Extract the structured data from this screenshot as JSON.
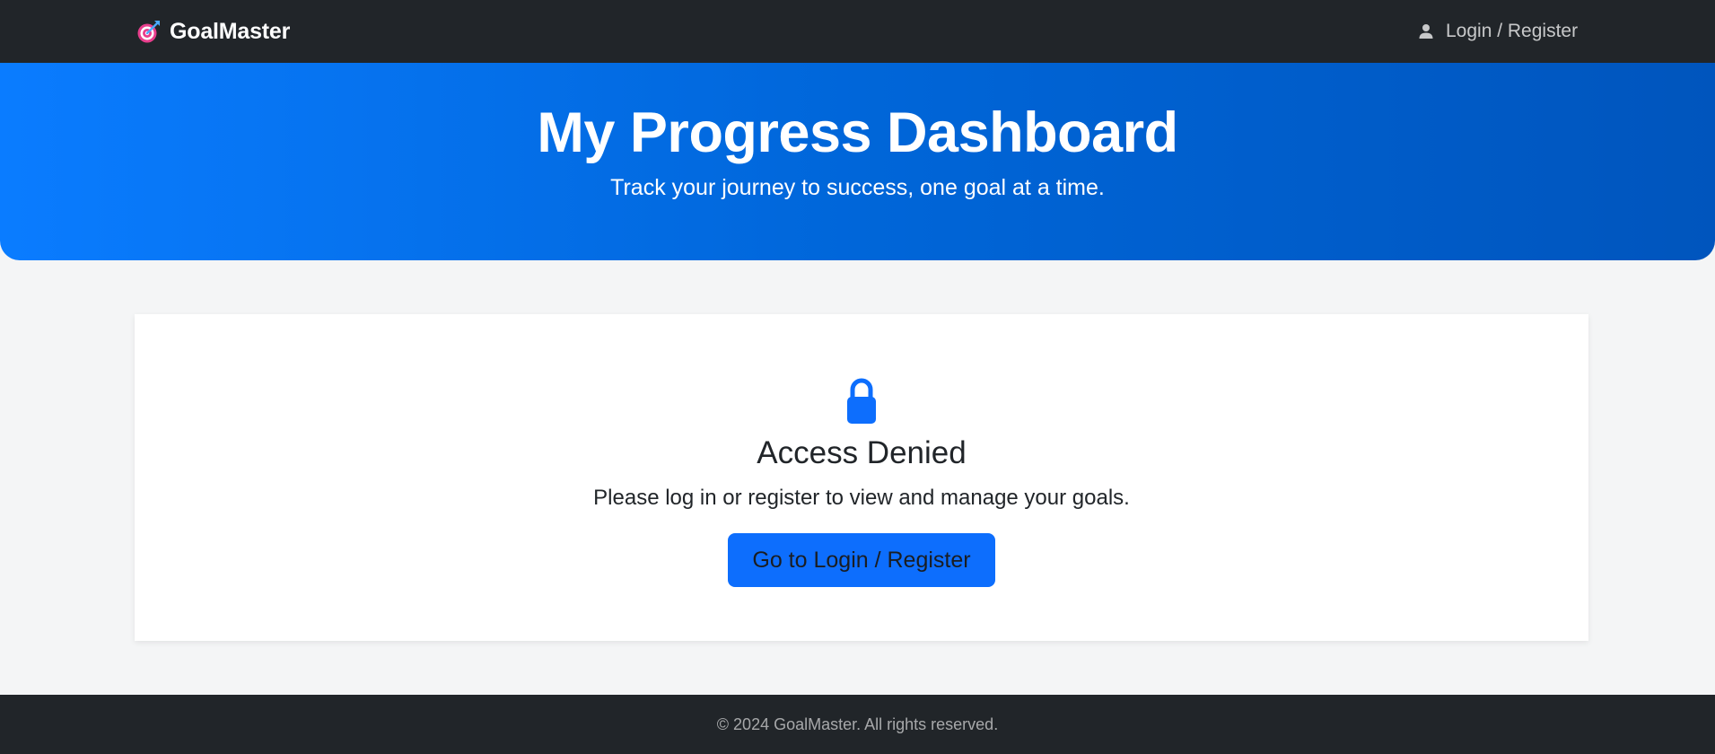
{
  "navbar": {
    "brand_icon": "target-arrow-icon",
    "brand_name": "GoalMaster",
    "login_icon": "user-icon",
    "login_label": "Login / Register"
  },
  "hero": {
    "title": "My Progress Dashboard",
    "subtitle": "Track your journey to success, one goal at a time."
  },
  "access_card": {
    "icon": "lock-icon",
    "title": "Access Denied",
    "message": "Please log in or register to view and manage your goals.",
    "button_label": "Go to Login / Register"
  },
  "footer": {
    "copyright": "© 2024 GoalMaster. All rights reserved."
  },
  "colors": {
    "navbar_bg": "#212529",
    "hero_gradient_start": "#0a7cff",
    "hero_gradient_end": "#0055bd",
    "primary": "#0d6efd",
    "page_bg": "#f4f5f6",
    "footer_bg": "#212529"
  }
}
